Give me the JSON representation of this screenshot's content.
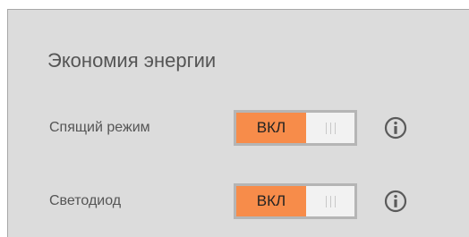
{
  "section": {
    "title": "Экономия энергии"
  },
  "settings": [
    {
      "label": "Спящий режим",
      "toggle_label": "ВКЛ",
      "state": "on",
      "icon": "info-icon"
    },
    {
      "label": "Светодиод",
      "toggle_label": "ВКЛ",
      "state": "on",
      "icon": "info-icon"
    }
  ],
  "colors": {
    "panel": "#dcdcdc",
    "toggle_on": "#f78c4a",
    "toggle_off": "#f2f2f2",
    "text": "#555555"
  }
}
